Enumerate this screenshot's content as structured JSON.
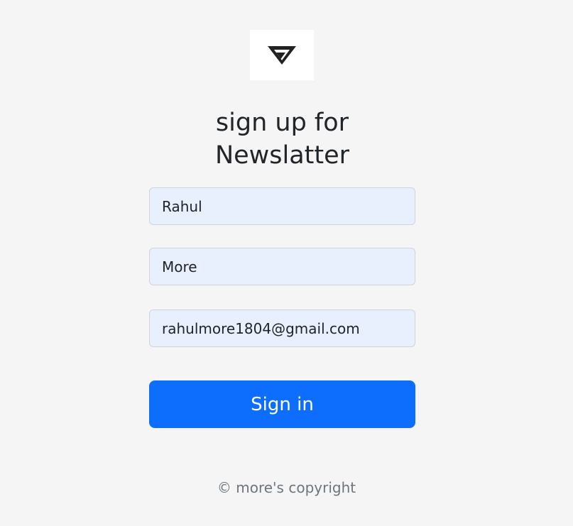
{
  "logo": {
    "icon": "triangle-logo-icon"
  },
  "heading": {
    "line1": "sign up for",
    "line2": "Newslatter"
  },
  "form": {
    "first_name": {
      "value": "Rahul"
    },
    "last_name": {
      "value": "More"
    },
    "email": {
      "value": "rahulmore1804@gmail.com"
    },
    "submit_label": "Sign in"
  },
  "footer": {
    "text": "© more's copyright"
  },
  "colors": {
    "background": "#f5f5f5",
    "primary": "#0d6efd",
    "field_background": "#e8f0fe",
    "text": "#212529",
    "muted": "#6c757d"
  }
}
